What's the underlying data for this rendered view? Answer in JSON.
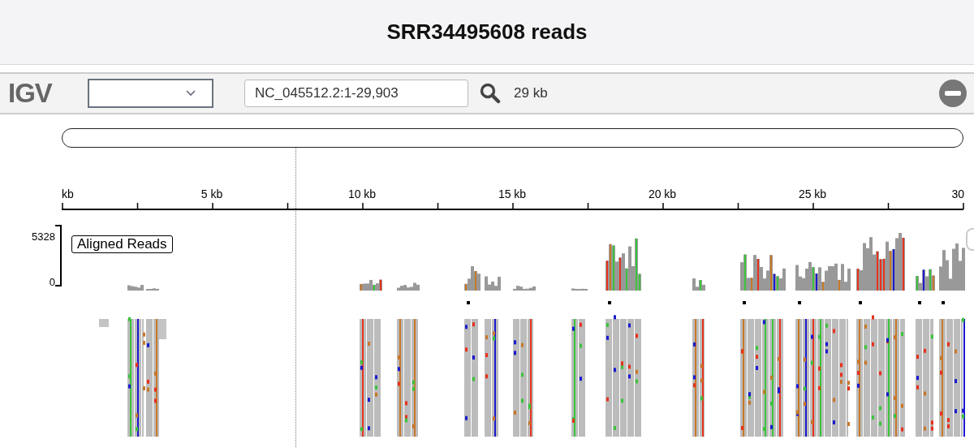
{
  "title": "SRR34495608 reads",
  "toolbar": {
    "logo": "IGV",
    "locus": {
      "value": "NC_045512.2:1-29,903"
    },
    "width_label": "29 kb"
  },
  "ruler": {
    "labels": [
      "kb",
      "5 kb",
      "10 kb",
      "15 kb",
      "20 kb",
      "25 kb",
      "30"
    ]
  },
  "track": {
    "name": "Aligned Reads",
    "scale_max": "5328",
    "scale_min": "0"
  }
}
